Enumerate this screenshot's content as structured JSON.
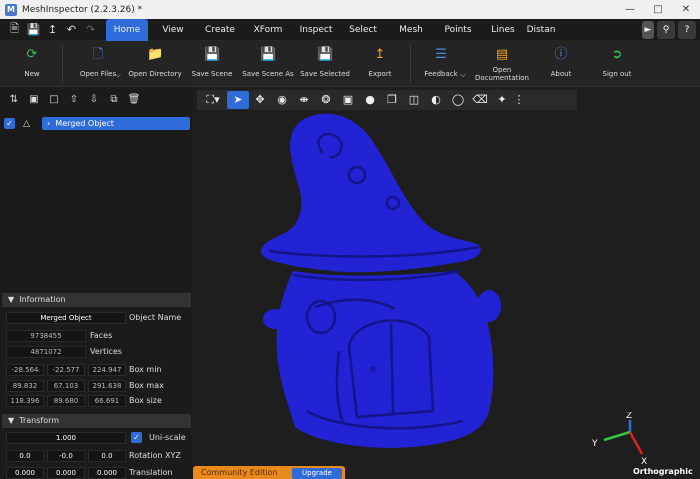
{
  "window": {
    "title": "MeshInspector (2.2.3.26) *",
    "logo": "M"
  },
  "quick_access": {
    "new_icon": "new-file-icon",
    "save_icon": "save-icon",
    "export_icon": "upload-icon",
    "undo_icon": "undo-icon",
    "redo_icon": "redo-icon"
  },
  "menu": {
    "tabs": [
      "Home",
      "View",
      "Create",
      "XForm",
      "Inspect",
      "Select",
      "Mesh",
      "Points",
      "Lines",
      "Distan"
    ],
    "active": "Home"
  },
  "ribbon": {
    "new": "New",
    "open_files": "Open Files",
    "open_directory": "Open Directory",
    "save_scene": "Save Scene",
    "save_scene_as": "Save Scene As",
    "save_selected": "Save Selected",
    "export": "Export",
    "feedback": "Feedback",
    "open_doc_1": "Open",
    "open_doc_2": "Documentation",
    "about": "About",
    "sign_out": "Sign out"
  },
  "scene": {
    "object_name": "Merged Object"
  },
  "information": {
    "header": "Information",
    "object_name_value": "Merged Object",
    "object_name_label": "Object Name",
    "faces_value": "9738455",
    "faces_label": "Faces",
    "vertices_value": "4871072",
    "vertices_label": "Vertices",
    "box_min": [
      "-28.564",
      "-22.577",
      "224.947"
    ],
    "box_min_label": "Box min",
    "box_max": [
      "89.832",
      "67.103",
      "291.638"
    ],
    "box_max_label": "Box max",
    "box_size": [
      "118.396",
      "89.680",
      "66.691"
    ],
    "box_size_label": "Box size"
  },
  "transform": {
    "header": "Transform",
    "uniscale_value": "1.000",
    "uniscale_label": "Uni-scale",
    "rotation": [
      "0.0",
      "-0.0",
      "0.0"
    ],
    "rotation_label": "Rotation XYZ",
    "translation": [
      "0.000",
      "0.000",
      "0.000"
    ],
    "translation_label": "Translation"
  },
  "viewport": {
    "projection": "Orthographic",
    "axis_x": "X",
    "axis_y": "Y",
    "axis_z": "Z",
    "mesh_color": "#2323d6",
    "community": "Community Edition",
    "upgrade": "Upgrade"
  },
  "colors": {
    "accent": "#2f6bd9",
    "community": "#e8891a"
  }
}
